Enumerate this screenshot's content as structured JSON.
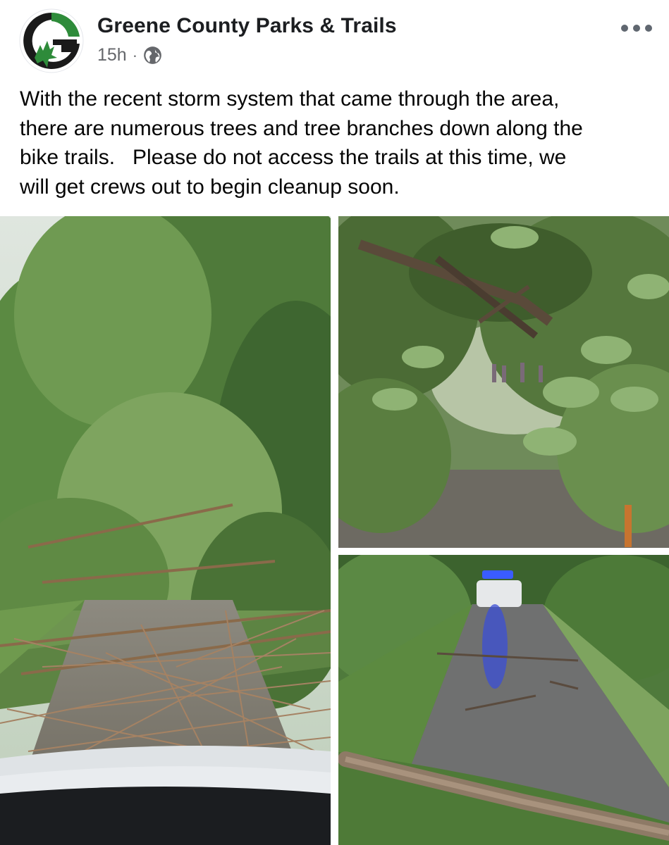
{
  "post": {
    "author": "Greene County Parks & Trails",
    "time": "15h",
    "separator": "·",
    "privacy_icon": "globe-icon",
    "more_icon": "more-options-icon",
    "text": "With the recent storm system that came through the area,\nthere are numerous trees and tree branches down along the\nbike trails.   Please do not access the trails at this time, we\nwill get crews out to begin cleanup soon."
  },
  "photos": [
    {
      "subject": "fallen branches across paved trail, viewed over car hood"
    },
    {
      "subject": "large fallen tree with leafy branches, people in background"
    },
    {
      "subject": "debris-covered trail with police vehicle with blue lights"
    }
  ],
  "colors": {
    "author": "#1c1e21",
    "meta": "#65676b",
    "brand_green": "#2e8b3a",
    "brand_dark": "#1a1a1a"
  }
}
